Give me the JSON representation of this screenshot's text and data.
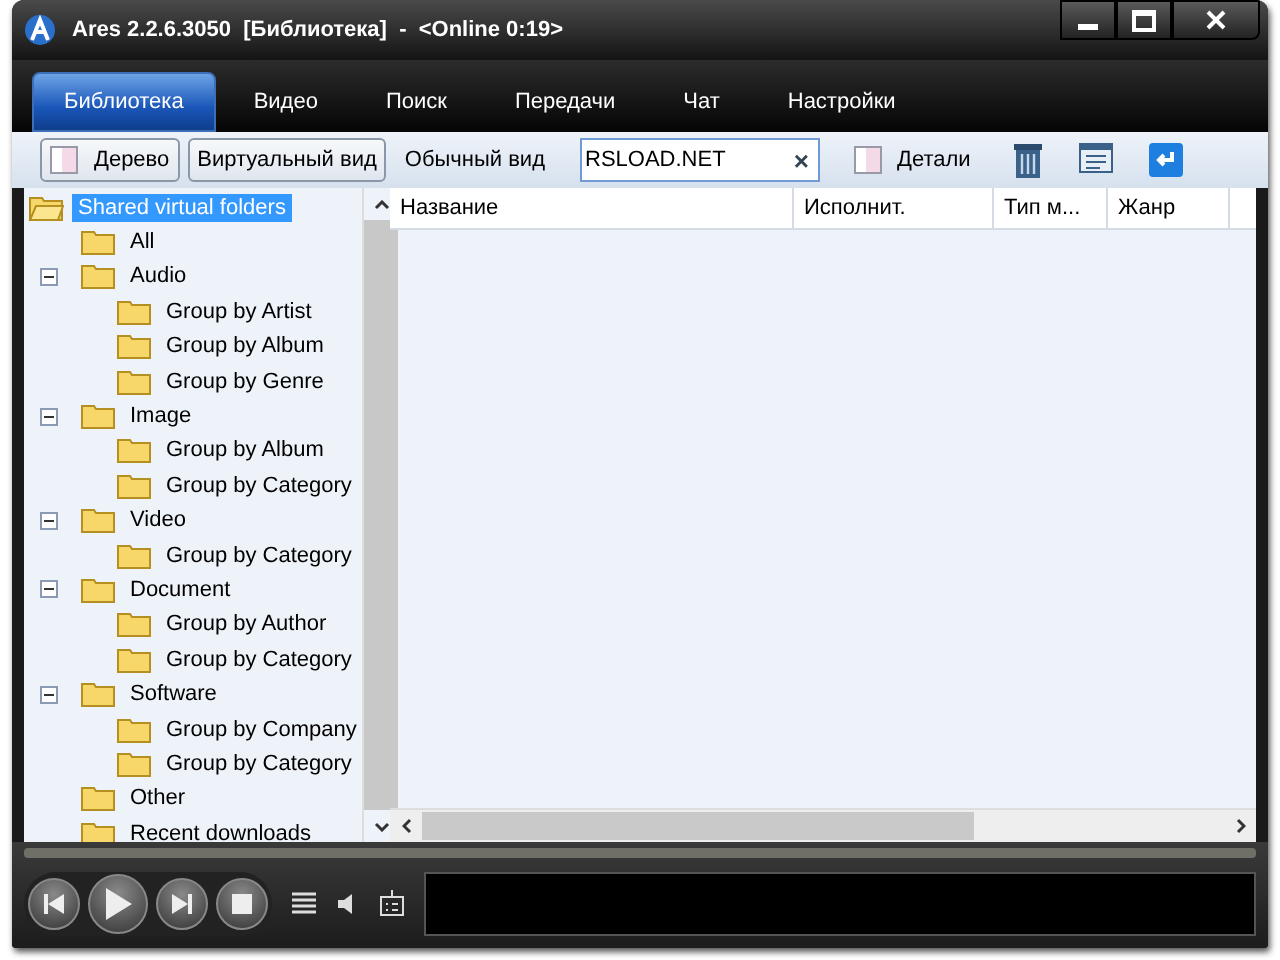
{
  "window": {
    "title": "Ares 2.2.6.3050  [Библиотека]  -  <Online 0:19>"
  },
  "tabs": [
    {
      "label": "Библиотека",
      "selected": true
    },
    {
      "label": "Видео",
      "selected": false
    },
    {
      "label": "Поиск",
      "selected": false
    },
    {
      "label": "Передачи",
      "selected": false
    },
    {
      "label": "Чат",
      "selected": false
    },
    {
      "label": "Настройки",
      "selected": false
    }
  ],
  "toolbar": {
    "items": [
      {
        "kind": "icon-button",
        "label": "Дерево"
      },
      {
        "kind": "button",
        "label": "Виртуальный вид"
      },
      {
        "kind": "plain",
        "label": "Обычный вид"
      }
    ],
    "search": {
      "value": "RSLOAD.NET",
      "clear": "×"
    },
    "details": "Детали"
  },
  "tree": [
    {
      "label": "Shared virtual folders",
      "selected": true,
      "expanded": true,
      "children": [
        {
          "label": "All",
          "selected": false
        },
        {
          "label": "Audio",
          "selected": false,
          "expanded": true,
          "children": [
            {
              "label": "Group by Artist",
              "selected": false
            },
            {
              "label": "Group by Album",
              "selected": false
            },
            {
              "label": "Group by Genre",
              "selected": false
            }
          ]
        },
        {
          "label": "Image",
          "selected": false,
          "expanded": true,
          "children": [
            {
              "label": "Group by Album",
              "selected": false
            },
            {
              "label": "Group by Category",
              "selected": false
            }
          ]
        },
        {
          "label": "Video",
          "selected": false,
          "expanded": true,
          "children": [
            {
              "label": "Group by Category",
              "selected": false
            }
          ]
        },
        {
          "label": "Document",
          "selected": false,
          "expanded": true,
          "children": [
            {
              "label": "Group by Author",
              "selected": false
            },
            {
              "label": "Group by Category",
              "selected": false
            }
          ]
        },
        {
          "label": "Software",
          "selected": false,
          "expanded": true,
          "children": [
            {
              "label": "Group by Company",
              "selected": false
            },
            {
              "label": "Group by Category",
              "selected": false
            }
          ]
        },
        {
          "label": "Other",
          "selected": false
        },
        {
          "label": "Recent downloads",
          "selected": false
        }
      ]
    }
  ],
  "table": {
    "columns": [
      "Название",
      "Исполнит.",
      "Тип м...",
      "Жанр"
    ]
  }
}
